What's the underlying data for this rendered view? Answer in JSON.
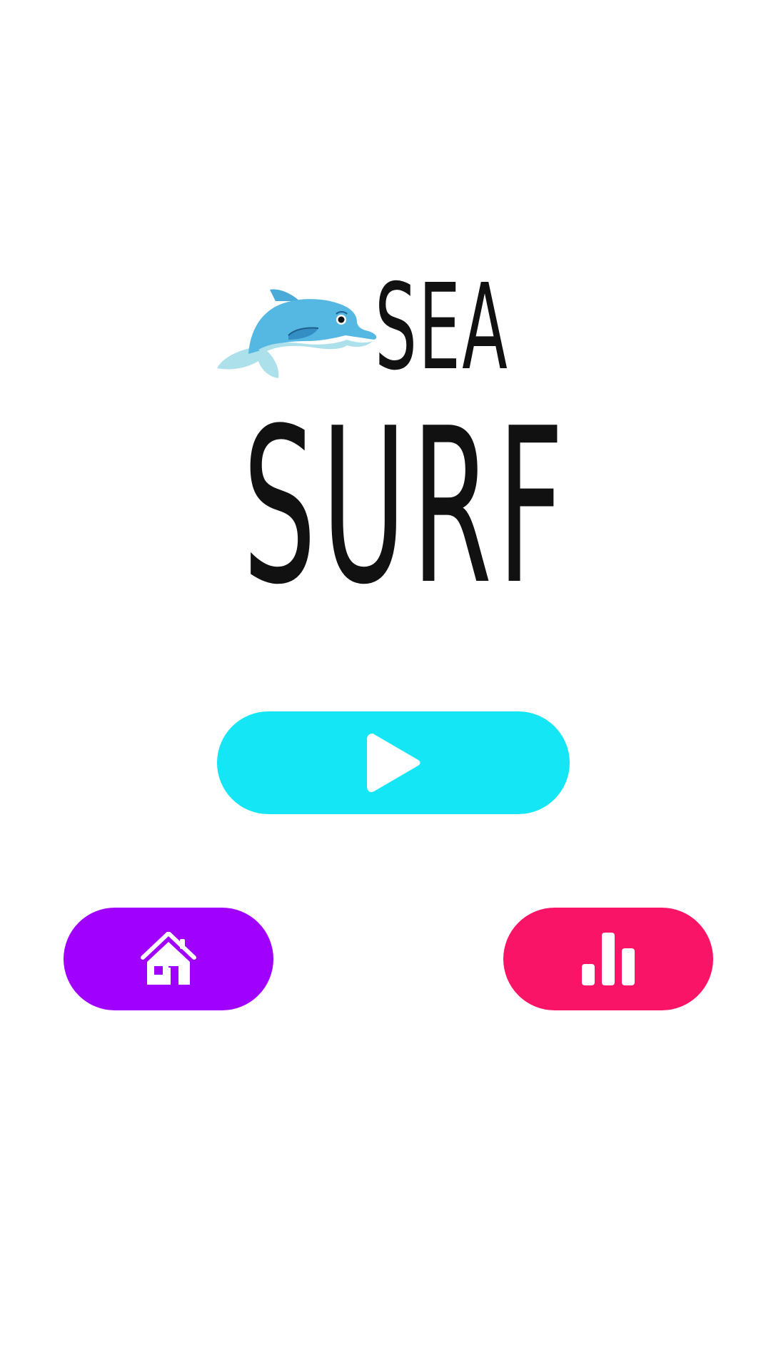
{
  "title": {
    "line1": "SEA",
    "line2": "SURF"
  },
  "logo": {
    "mascot": "dolphin-icon"
  },
  "buttons": {
    "play": {
      "icon": "play-icon",
      "color": "#15E6F6"
    },
    "home": {
      "icon": "home-icon",
      "color": "#A000FE"
    },
    "stats": {
      "icon": "bar-chart-icon",
      "color": "#FA1468"
    }
  },
  "colors": {
    "background": "#FFFFFF",
    "title_text": "#111111",
    "icon_fill": "#FFFFFF",
    "dolphin_body": "#55B8E2",
    "dolphin_belly": "#ACE0EA"
  }
}
